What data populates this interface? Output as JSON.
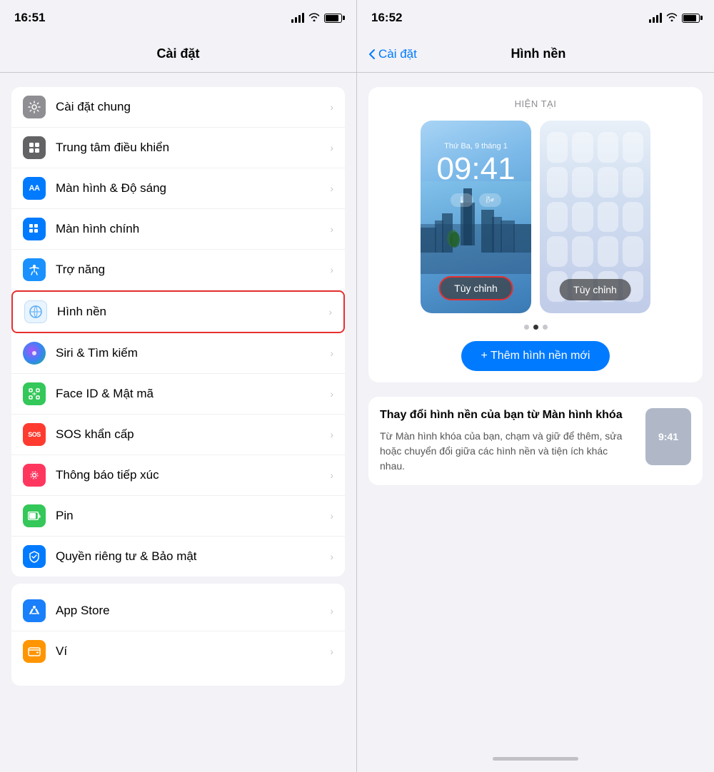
{
  "left": {
    "statusBar": {
      "time": "16:51"
    },
    "header": {
      "title": "Cài đặt"
    },
    "settingsItems": [
      {
        "id": "cai-dat-chung",
        "label": "Cài đặt chung",
        "iconBg": "icon-gray",
        "iconChar": "⚙️"
      },
      {
        "id": "trung-tam-dieu-khien",
        "label": "Trung tâm điều khiển",
        "iconBg": "icon-dark-gray",
        "iconChar": "⊞"
      },
      {
        "id": "man-hinh-do-sang",
        "label": "Màn hình & Độ sáng",
        "iconBg": "icon-blue-aa",
        "iconChar": "AA"
      },
      {
        "id": "man-hinh-chinh",
        "label": "Màn hình chính",
        "iconBg": "icon-blue-grid",
        "iconChar": "⊞"
      },
      {
        "id": "tro-nang",
        "label": "Trợ năng",
        "iconBg": "icon-blue-access",
        "iconChar": "♿"
      },
      {
        "id": "hinh-nen",
        "label": "Hình nền",
        "iconBg": "icon-teal-flower",
        "iconChar": "✿",
        "highlighted": true
      },
      {
        "id": "siri-tim-kiem",
        "label": "Siri & Tìm kiếm",
        "iconBg": "icon-siri",
        "iconChar": "◉"
      },
      {
        "id": "face-id",
        "label": "Face ID & Mật mã",
        "iconBg": "icon-green",
        "iconChar": "☺"
      },
      {
        "id": "sos-khan-cap",
        "label": "SOS khẩn cấp",
        "iconBg": "icon-red-sos",
        "iconChar": "SOS"
      },
      {
        "id": "thong-bao-tiep-xuc",
        "label": "Thông báo tiếp xúc",
        "iconBg": "icon-pink-dots",
        "iconChar": "⊛"
      },
      {
        "id": "pin",
        "label": "Pin",
        "iconBg": "icon-green-battery",
        "iconChar": "🔋"
      },
      {
        "id": "quyen-rieng-tu",
        "label": "Quyền riêng tư & Bảo mật",
        "iconBg": "icon-blue-hand",
        "iconChar": "✋"
      }
    ],
    "bottomItems": [
      {
        "id": "app-store",
        "label": "App Store",
        "iconBg": "icon-blue-store",
        "iconChar": "A"
      },
      {
        "id": "vi",
        "label": "Ví",
        "iconBg": "icon-yellow-wallet",
        "iconChar": "◫"
      }
    ]
  },
  "right": {
    "statusBar": {
      "time": "16:52"
    },
    "header": {
      "backLabel": "Cài đặt",
      "title": "Hình nền"
    },
    "currentLabel": "HIỆN TẠI",
    "lockScreen": {
      "date": "Thứ Ba, 9 tháng 1",
      "time": "09:41"
    },
    "customizeBtn1": "Tùy chỉnh",
    "customizeBtn2": "Tùy chỉnh",
    "addWallpaperBtn": "+ Thêm hình nền mới",
    "infoSection": {
      "title": "Thay đổi hình nền của bạn từ Màn hình khóa",
      "body": "Từ Màn hình khóa của bạn, chạm và giữ để thêm, sửa hoặc chuyển đổi giữa các hình nền và tiện ích khác nhau.",
      "thumbTime": "9:41"
    }
  }
}
